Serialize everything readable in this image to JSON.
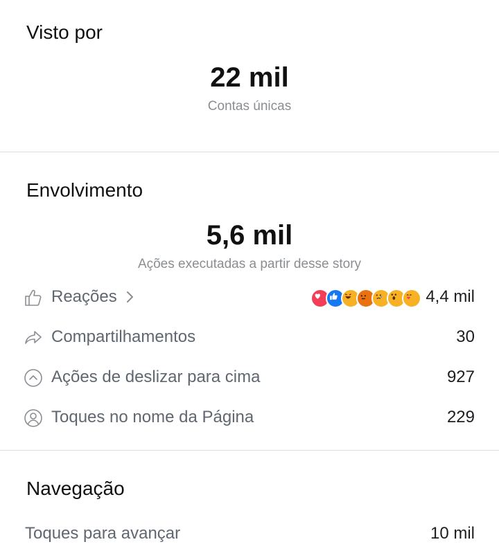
{
  "viewed_by": {
    "title": "Visto por",
    "count": "22 mil",
    "caption": "Contas únicas"
  },
  "engagement": {
    "title": "Envolvimento",
    "count": "5,6 mil",
    "caption": "Ações executadas a partir desse story",
    "rows": [
      {
        "label": "Reações",
        "value": "4,4 mil",
        "icon": "thumbs-up-icon"
      },
      {
        "label": "Compartilhamentos",
        "value": "30",
        "icon": "share-arrow-icon"
      },
      {
        "label": "Ações de deslizar para cima",
        "value": "927",
        "icon": "swipe-up-icon"
      },
      {
        "label": "Toques no nome da Página",
        "value": "229",
        "icon": "profile-circle-icon"
      }
    ],
    "reaction_emojis": [
      "love",
      "like",
      "haha",
      "angry",
      "sad",
      "wow",
      "care"
    ]
  },
  "navigation": {
    "title": "Navegação",
    "rows": [
      {
        "label": "Toques para avançar",
        "value": "10 mil"
      }
    ]
  },
  "colors": {
    "love": "#f33e58",
    "like": "#1877f2",
    "yellow": "#f7b125",
    "angry": "#e9710f"
  }
}
